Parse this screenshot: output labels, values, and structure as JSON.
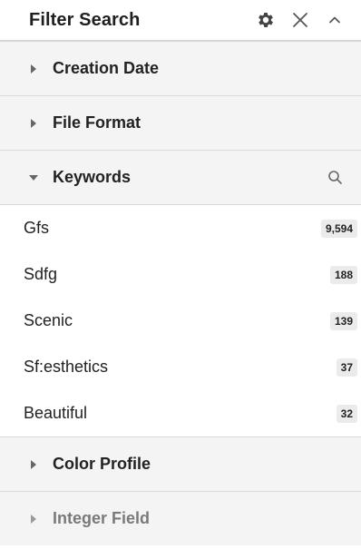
{
  "header": {
    "title": "Filter Search",
    "icons": [
      "gear-icon",
      "close-icon",
      "chevron-up-icon"
    ]
  },
  "sections_before": [
    {
      "label": "Creation Date",
      "state": "collapsed"
    },
    {
      "label": "File Format",
      "state": "collapsed"
    }
  ],
  "keywords_section": {
    "label": "Keywords",
    "state": "expanded",
    "items": [
      {
        "label": "Gfs",
        "count": "9,594"
      },
      {
        "label": "Sdfg",
        "count": "188"
      },
      {
        "label": "Scenic",
        "count": "139"
      },
      {
        "label": "Sf:esthetics",
        "count": "37"
      },
      {
        "label": "Beautiful",
        "count": "32"
      }
    ]
  },
  "sections_after": [
    {
      "label": "Color Profile",
      "state": "collapsed"
    },
    {
      "label": "Integer Field",
      "state": "collapsed"
    }
  ],
  "colors": {
    "section_bg": "#f4f4f4",
    "badge_bg": "#ebebeb",
    "text": "#1f1f1f",
    "muted_text": "#7a7a7a",
    "icon": "#444444"
  }
}
